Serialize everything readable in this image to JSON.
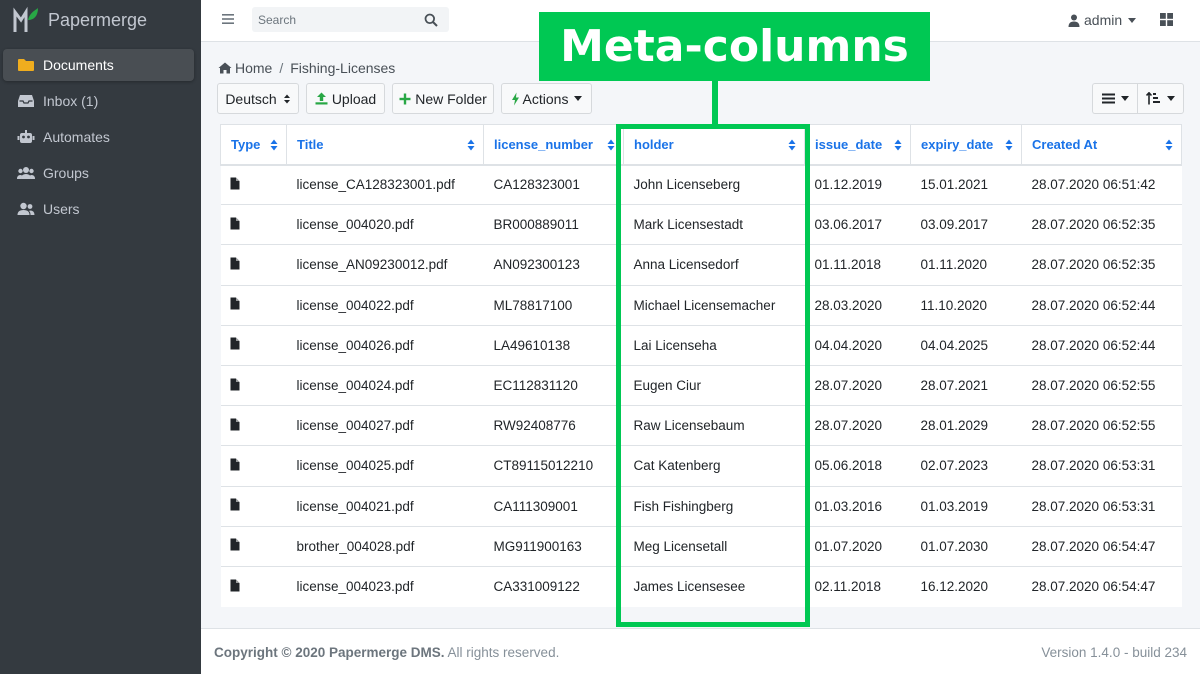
{
  "app": {
    "name": "Papermerge"
  },
  "sidebar": {
    "items": [
      {
        "label": "Documents",
        "icon": "folder-icon"
      },
      {
        "label": "Inbox (1)",
        "icon": "inbox-icon"
      },
      {
        "label": "Automates",
        "icon": "robot-icon"
      },
      {
        "label": "Groups",
        "icon": "users-group-icon"
      },
      {
        "label": "Users",
        "icon": "user-icon"
      }
    ]
  },
  "topbar": {
    "search_placeholder": "Search",
    "user": "admin"
  },
  "breadcrumb": {
    "home": "Home",
    "current": "Fishing-Licenses"
  },
  "toolbar": {
    "language": "Deutsch",
    "upload": "Upload",
    "new_folder": "New Folder",
    "actions": "Actions"
  },
  "table": {
    "columns": [
      "Type",
      "Title",
      "license_number",
      "holder",
      "issue_date",
      "expiry_date",
      "Created At"
    ],
    "rows": [
      {
        "title": "license_CA128323001.pdf",
        "license_number": "CA128323001",
        "holder": "John Licenseberg",
        "issue_date": "01.12.2019",
        "expiry_date": "15.01.2021",
        "created_at": "28.07.2020 06:51:42"
      },
      {
        "title": "license_004020.pdf",
        "license_number": "BR000889011",
        "holder": "Mark Licensestadt",
        "issue_date": "03.06.2017",
        "expiry_date": "03.09.2017",
        "created_at": "28.07.2020 06:52:35"
      },
      {
        "title": "license_AN09230012.pdf",
        "license_number": "AN092300123",
        "holder": "Anna Licensedorf",
        "issue_date": "01.11.2018",
        "expiry_date": "01.11.2020",
        "created_at": "28.07.2020 06:52:35"
      },
      {
        "title": "license_004022.pdf",
        "license_number": "ML78817100",
        "holder": "Michael Licensemacher",
        "issue_date": "28.03.2020",
        "expiry_date": "11.10.2020",
        "created_at": "28.07.2020 06:52:44"
      },
      {
        "title": "license_004026.pdf",
        "license_number": "LA49610138",
        "holder": "Lai Licenseha",
        "issue_date": "04.04.2020",
        "expiry_date": "04.04.2025",
        "created_at": "28.07.2020 06:52:44"
      },
      {
        "title": "license_004024.pdf",
        "license_number": "EC112831120",
        "holder": "Eugen Ciur",
        "issue_date": "28.07.2020",
        "expiry_date": "28.07.2021",
        "created_at": "28.07.2020 06:52:55"
      },
      {
        "title": "license_004027.pdf",
        "license_number": "RW92408776",
        "holder": "Raw Licensebaum",
        "issue_date": "28.07.2020",
        "expiry_date": "28.01.2029",
        "created_at": "28.07.2020 06:52:55"
      },
      {
        "title": "license_004025.pdf",
        "license_number": "CT89115012210",
        "holder": "Cat Katenberg",
        "issue_date": "05.06.2018",
        "expiry_date": "02.07.2023",
        "created_at": "28.07.2020 06:53:31"
      },
      {
        "title": "license_004021.pdf",
        "license_number": "CA111309001",
        "holder": "Fish Fishingberg",
        "issue_date": "01.03.2016",
        "expiry_date": "01.03.2019",
        "created_at": "28.07.2020 06:53:31"
      },
      {
        "title": "brother_004028.pdf",
        "license_number": "MG911900163",
        "holder": "Meg Licensetall",
        "issue_date": "01.07.2020",
        "expiry_date": "01.07.2030",
        "created_at": "28.07.2020 06:54:47"
      },
      {
        "title": "license_004023.pdf",
        "license_number": "CA331009122",
        "holder": "James Licensesee",
        "issue_date": "02.11.2018",
        "expiry_date": "16.12.2020",
        "created_at": "28.07.2020 06:54:47"
      }
    ]
  },
  "annotation": {
    "label": "Meta-columns"
  },
  "footer": {
    "copyright_prefix": "Copyright © 2020 ",
    "brand": "Papermerge DMS.",
    "suffix": " All rights reserved.",
    "version": "Version 1.4.0 - build 234"
  },
  "colors": {
    "accent": "#1a73e8",
    "annotation": "#00c853",
    "sidebar": "#343a40",
    "folder": "#f0ad1e",
    "green_icon": "#28a745"
  }
}
